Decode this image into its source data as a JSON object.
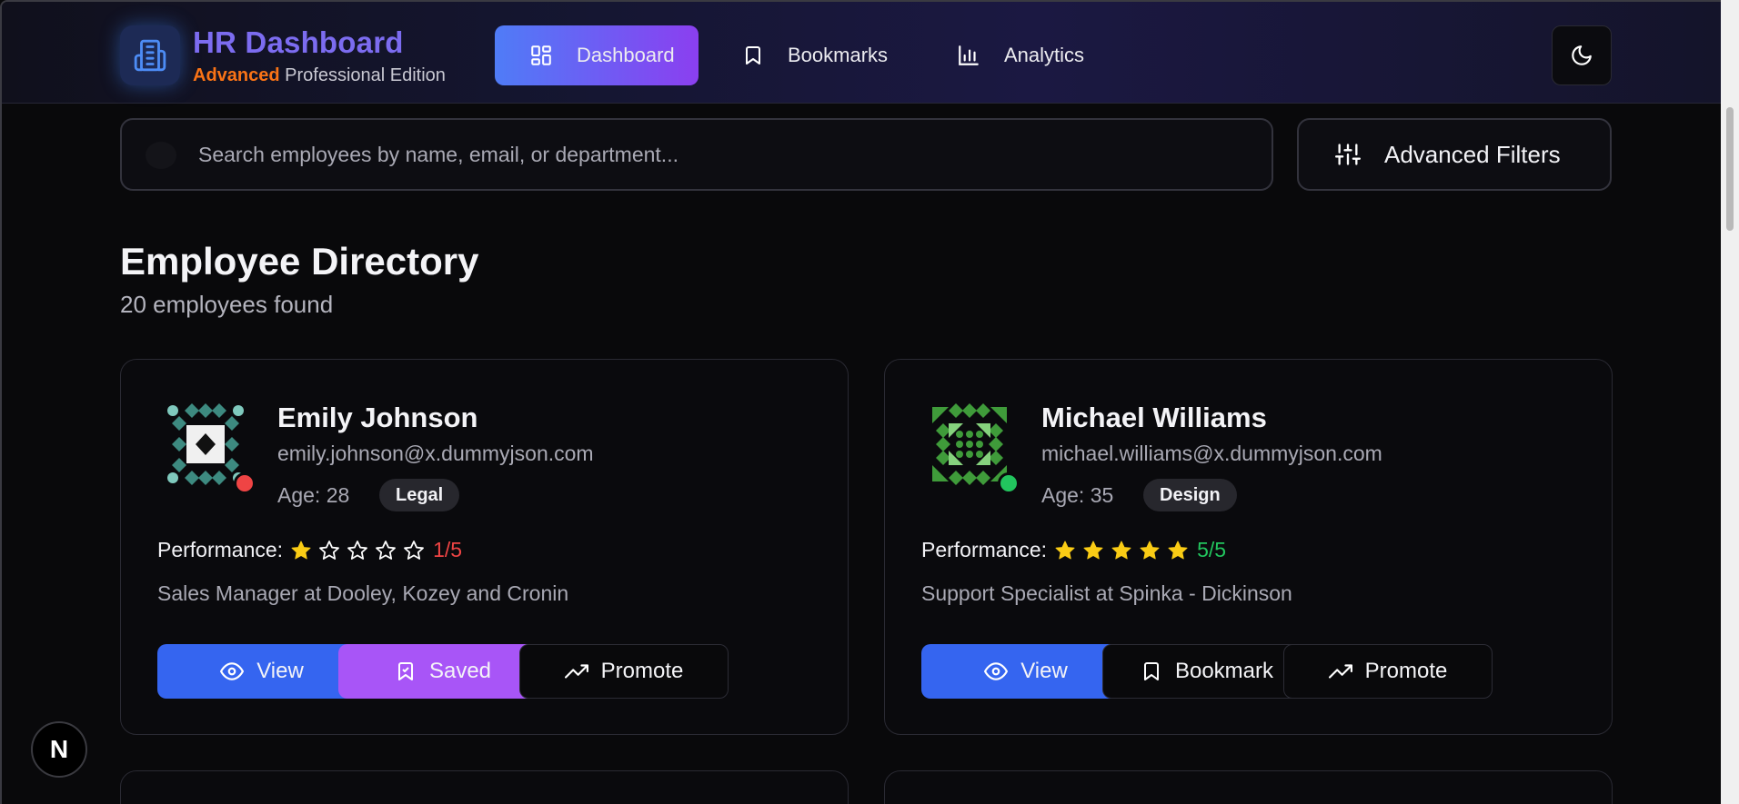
{
  "header": {
    "brand_title": "HR Dashboard",
    "brand_sub_accent": "Advanced",
    "brand_sub_rest": " Professional Edition",
    "nav": [
      {
        "label": "Dashboard",
        "icon": "grid-icon",
        "active": true
      },
      {
        "label": "Bookmarks",
        "icon": "bookmark-icon",
        "active": false
      },
      {
        "label": "Analytics",
        "icon": "bar-chart-icon",
        "active": false
      }
    ],
    "theme_toggle_icon": "moon-icon"
  },
  "search": {
    "placeholder": "Search employees by name, email, or department...",
    "value": ""
  },
  "filters": {
    "label": "Advanced Filters",
    "icon": "sliders-icon"
  },
  "directory": {
    "title": "Employee Directory",
    "count_text": "20 employees found"
  },
  "employees": [
    {
      "name": "Emily Johnson",
      "email": "emily.johnson@x.dummyjson.com",
      "age_text": "Age: 28",
      "department": "Legal",
      "status_color": "#ef4444",
      "performance_label": "Performance:",
      "rating": 1,
      "rating_max": 5,
      "rating_text": "1/5",
      "rating_color": "#ef4444",
      "job": "Sales Manager at Dooley, Kozey and Cronin",
      "avatar_colors": {
        "primary": "#3d8a80",
        "secondary": "#7fc9bd"
      },
      "actions": {
        "view": "View",
        "bookmark": "Saved",
        "bookmark_state": "saved",
        "promote": "Promote"
      }
    },
    {
      "name": "Michael Williams",
      "email": "michael.williams@x.dummyjson.com",
      "age_text": "Age: 35",
      "department": "Design",
      "status_color": "#22c55e",
      "performance_label": "Performance:",
      "rating": 5,
      "rating_max": 5,
      "rating_text": "5/5",
      "rating_color": "#22c55e",
      "job": "Support Specialist at Spinka - Dickinson",
      "avatar_colors": {
        "primary": "#3f9b3a",
        "secondary": "#86d27e"
      },
      "actions": {
        "view": "View",
        "bookmark": "Bookmark",
        "bookmark_state": "unsaved",
        "promote": "Promote"
      }
    }
  ],
  "misc": {
    "next_badge": "N"
  },
  "colors": {
    "accent_blue": "#3565f0",
    "accent_purple": "#a855f7",
    "star_filled": "#facc15",
    "background": "#09090b"
  }
}
